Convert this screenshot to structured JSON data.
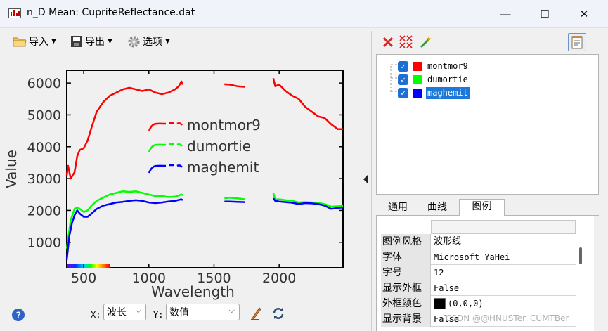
{
  "window": {
    "title": "n_D Mean: CupriteReflectance.dat",
    "min_glyph": "—",
    "max_glyph": "☐",
    "close_glyph": "✕"
  },
  "toolbar": {
    "import_label": "导入",
    "export_label": "导出",
    "options_label": "选项"
  },
  "chart_data": {
    "type": "line",
    "xlabel": "Wavelength",
    "ylabel": "Value",
    "xlim": [
      370,
      2490
    ],
    "ylim": [
      200,
      6400
    ],
    "x_ticks": [
      500,
      1000,
      1500,
      2000
    ],
    "y_ticks": [
      1000,
      2000,
      3000,
      4000,
      5000,
      6000
    ],
    "gaps": [
      [
        1265,
        1575
      ],
      [
        1760,
        1950
      ]
    ],
    "legend": {
      "placement": "center",
      "style": "wave"
    },
    "series": [
      {
        "name": "montmor9",
        "color": "#ff0000",
        "points": [
          [
            370,
            3100
          ],
          [
            380,
            3400
          ],
          [
            400,
            3000
          ],
          [
            430,
            3200
          ],
          [
            450,
            3700
          ],
          [
            470,
            3900
          ],
          [
            500,
            3950
          ],
          [
            530,
            4200
          ],
          [
            560,
            4600
          ],
          [
            600,
            5100
          ],
          [
            650,
            5400
          ],
          [
            700,
            5600
          ],
          [
            750,
            5700
          ],
          [
            800,
            5800
          ],
          [
            850,
            5850
          ],
          [
            900,
            5800
          ],
          [
            950,
            5750
          ],
          [
            1000,
            5800
          ],
          [
            1050,
            5700
          ],
          [
            1100,
            5650
          ],
          [
            1150,
            5700
          ],
          [
            1200,
            5800
          ],
          [
            1230,
            5900
          ],
          [
            1250,
            6050
          ],
          [
            1260,
            5950
          ],
          [
            1580,
            5960
          ],
          [
            1620,
            5950
          ],
          [
            1680,
            5900
          ],
          [
            1740,
            5880
          ],
          [
            1955,
            6150
          ],
          [
            1970,
            5900
          ],
          [
            2000,
            5950
          ],
          [
            2050,
            5750
          ],
          [
            2100,
            5600
          ],
          [
            2150,
            5500
          ],
          [
            2200,
            5250
          ],
          [
            2250,
            5100
          ],
          [
            2300,
            4950
          ],
          [
            2350,
            4900
          ],
          [
            2400,
            4700
          ],
          [
            2450,
            4550
          ],
          [
            2490,
            4550
          ]
        ]
      },
      {
        "name": "dumortie",
        "color": "#00ff00",
        "points": [
          [
            370,
            800
          ],
          [
            400,
            1700
          ],
          [
            430,
            2050
          ],
          [
            450,
            2100
          ],
          [
            470,
            2050
          ],
          [
            500,
            1950
          ],
          [
            530,
            2000
          ],
          [
            560,
            2150
          ],
          [
            600,
            2300
          ],
          [
            650,
            2400
          ],
          [
            700,
            2500
          ],
          [
            750,
            2550
          ],
          [
            800,
            2600
          ],
          [
            850,
            2580
          ],
          [
            900,
            2600
          ],
          [
            950,
            2550
          ],
          [
            1000,
            2500
          ],
          [
            1050,
            2450
          ],
          [
            1100,
            2450
          ],
          [
            1150,
            2420
          ],
          [
            1200,
            2430
          ],
          [
            1250,
            2500
          ],
          [
            1260,
            2480
          ],
          [
            1580,
            2380
          ],
          [
            1620,
            2400
          ],
          [
            1680,
            2380
          ],
          [
            1740,
            2350
          ],
          [
            1955,
            2550
          ],
          [
            1970,
            2350
          ],
          [
            2000,
            2350
          ],
          [
            2050,
            2320
          ],
          [
            2100,
            2300
          ],
          [
            2150,
            2250
          ],
          [
            2200,
            2260
          ],
          [
            2250,
            2250
          ],
          [
            2300,
            2230
          ],
          [
            2350,
            2200
          ],
          [
            2400,
            2120
          ],
          [
            2450,
            2130
          ],
          [
            2490,
            2140
          ]
        ]
      },
      {
        "name": "maghemit",
        "color": "#0000ff",
        "points": [
          [
            370,
            450
          ],
          [
            390,
            1200
          ],
          [
            410,
            1600
          ],
          [
            430,
            1850
          ],
          [
            450,
            2000
          ],
          [
            470,
            1900
          ],
          [
            500,
            1800
          ],
          [
            530,
            1800
          ],
          [
            560,
            1900
          ],
          [
            600,
            2050
          ],
          [
            650,
            2150
          ],
          [
            700,
            2200
          ],
          [
            750,
            2250
          ],
          [
            800,
            2270
          ],
          [
            850,
            2300
          ],
          [
            900,
            2320
          ],
          [
            950,
            2300
          ],
          [
            1000,
            2250
          ],
          [
            1050,
            2230
          ],
          [
            1100,
            2250
          ],
          [
            1150,
            2280
          ],
          [
            1200,
            2300
          ],
          [
            1250,
            2350
          ],
          [
            1260,
            2320
          ],
          [
            1580,
            2280
          ],
          [
            1620,
            2280
          ],
          [
            1680,
            2270
          ],
          [
            1740,
            2260
          ],
          [
            1955,
            2380
          ],
          [
            1970,
            2300
          ],
          [
            2000,
            2280
          ],
          [
            2050,
            2260
          ],
          [
            2100,
            2240
          ],
          [
            2150,
            2200
          ],
          [
            2200,
            2230
          ],
          [
            2250,
            2220
          ],
          [
            2300,
            2200
          ],
          [
            2350,
            2150
          ],
          [
            2400,
            2050
          ],
          [
            2450,
            2080
          ],
          [
            2490,
            2090
          ]
        ]
      }
    ]
  },
  "bottom": {
    "help_glyph": "?",
    "x_label": "X:",
    "x_value": "波长",
    "y_label": "Y:",
    "y_value": "数值",
    "dropdown_glyph": "⌵"
  },
  "tree": {
    "check_glyph": "✓",
    "items": [
      {
        "label": "montmor9",
        "color": "#ff0000",
        "selected": false
      },
      {
        "label": "dumortie",
        "color": "#00ff00",
        "selected": false
      },
      {
        "label": "maghemit",
        "color": "#0000ff",
        "selected": true
      }
    ]
  },
  "tabs": [
    {
      "label": "通用",
      "active": false
    },
    {
      "label": "曲线",
      "active": false
    },
    {
      "label": "图例",
      "active": true
    }
  ],
  "properties": [
    {
      "name": "图例风格",
      "value": "波形线",
      "cjk": true
    },
    {
      "name": "字体",
      "value": "Microsoft YaHei",
      "cjk": false
    },
    {
      "name": "字号",
      "value": "12",
      "cjk": false
    },
    {
      "name": "显示外框",
      "value": "False",
      "cjk": false
    },
    {
      "name": "外框颜色",
      "value": "(0,0,0)",
      "cjk": false,
      "swatch": "#000000"
    },
    {
      "name": "显示背景",
      "value": "False",
      "cjk": false
    }
  ],
  "watermark": "CSDN @@HNUSTer_CUMTBer"
}
